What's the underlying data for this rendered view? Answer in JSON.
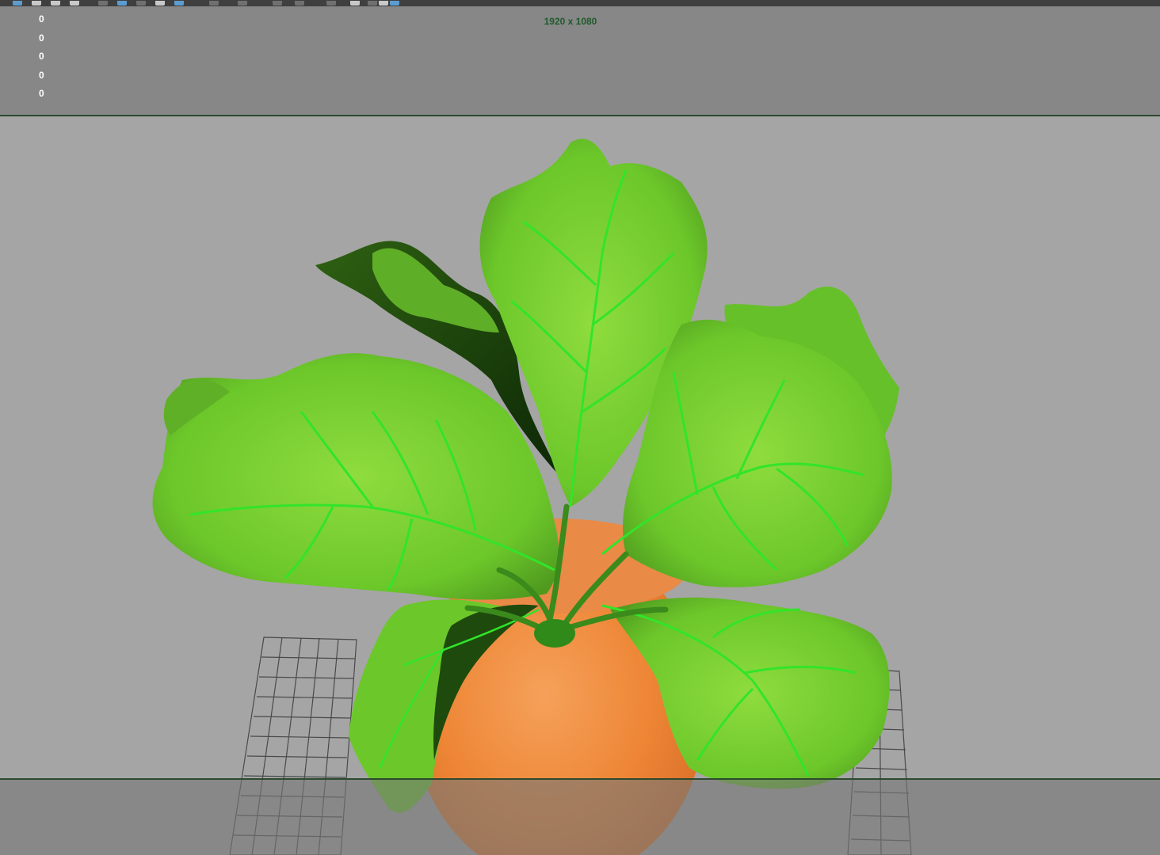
{
  "toolbar": {
    "icons": [
      {
        "name": "select-icon",
        "active": true
      },
      {
        "name": "lasso-icon",
        "active": false
      },
      {
        "name": "paint-select-icon",
        "active": false
      },
      {
        "name": "move-icon",
        "active": false
      },
      {
        "name": "rotate-icon",
        "active": false
      },
      {
        "name": "scale-icon",
        "active": true
      },
      {
        "name": "soft-mod-icon",
        "active": false
      },
      {
        "name": "snap-grid-icon",
        "active": false
      },
      {
        "name": "snap-curve-icon",
        "active": true
      },
      {
        "name": "snap-point-icon",
        "active": false
      },
      {
        "name": "render-icon",
        "active": false
      },
      {
        "name": "ipr-render-icon",
        "active": false
      },
      {
        "name": "render-settings-icon",
        "active": false
      },
      {
        "name": "hypershade-icon",
        "active": false
      },
      {
        "name": "camera-icon",
        "active": false
      },
      {
        "name": "shading-icon",
        "active": false
      },
      {
        "name": "lights-icon",
        "active": false
      },
      {
        "name": "xray-icon",
        "active": true
      }
    ]
  },
  "hud": {
    "poly_counts": [
      "0",
      "0",
      "0",
      "0",
      "0"
    ],
    "resolution": "1920 x 1080"
  },
  "colors": {
    "viewport_bg": "#a5a5a5",
    "gate_mask": "#878787",
    "gate_line": "#2c4a2e",
    "leaf": "#6fcd2c",
    "leaf_vein": "#33e62a",
    "root": "#f08a3c"
  }
}
